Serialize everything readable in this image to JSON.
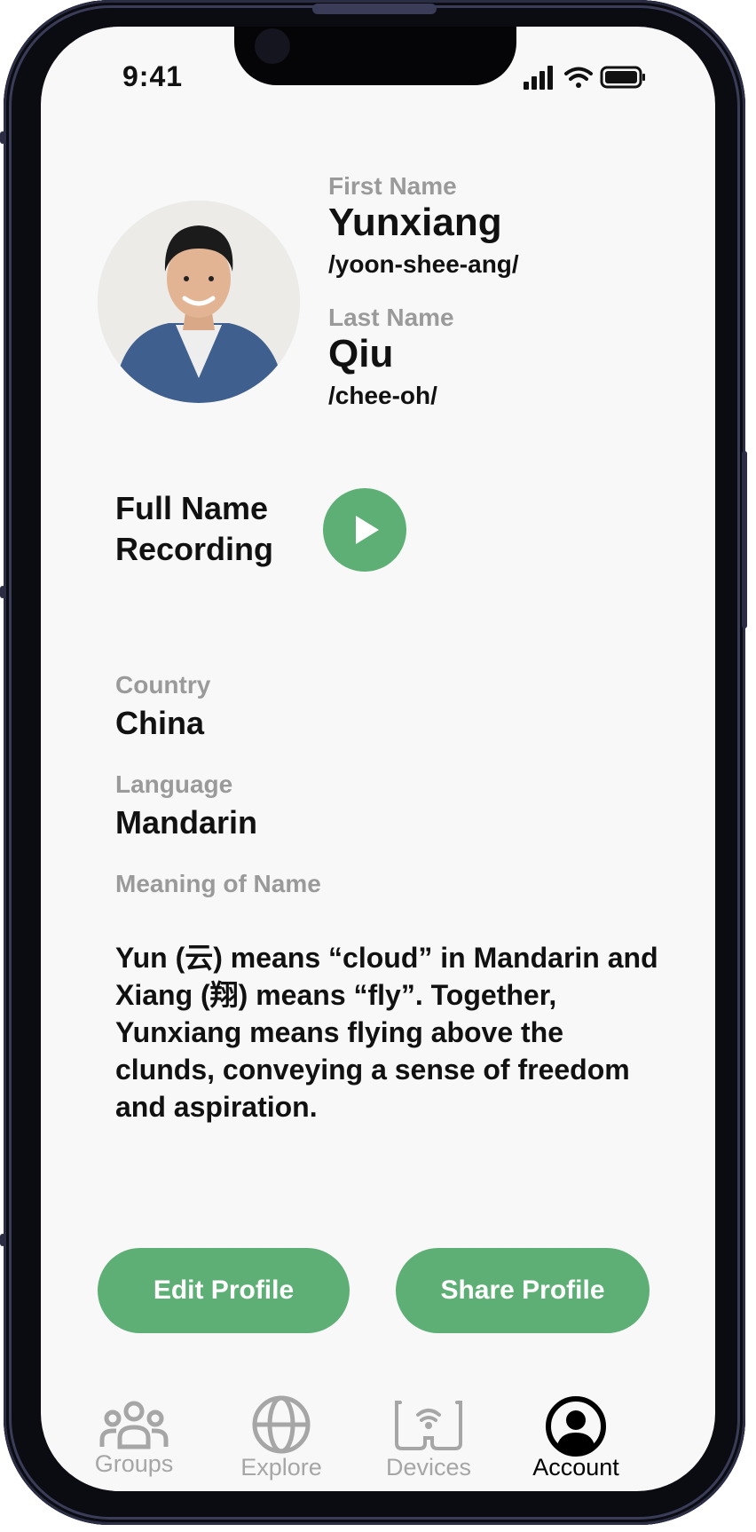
{
  "status": {
    "time": "9:41"
  },
  "profile": {
    "first_name_label": "First Name",
    "first_name": "Yunxiang",
    "first_name_phonetic": "/yoon-shee-ang/",
    "last_name_label": "Last Name",
    "last_name": "Qiu",
    "last_name_phonetic": "/chee-oh/",
    "recording_label_line1": "Full Name",
    "recording_label_line2": "Recording",
    "country_label": "Country",
    "country": "China",
    "language_label": "Language",
    "language": "Mandarin",
    "meaning_label": "Meaning of Name",
    "meaning": "Yun (云) means “cloud” in Mandarin and Xiang (翔) means  “fly”. Together, Yunxiang means flying above the clunds, conveying a sense of freedom and aspiration."
  },
  "actions": {
    "edit_label": "Edit Profile",
    "share_label": "Share Profile"
  },
  "tabs": [
    {
      "label": "Groups",
      "icon": "groups-icon",
      "active": false
    },
    {
      "label": "Explore",
      "icon": "globe-icon",
      "active": false
    },
    {
      "label": "Devices",
      "icon": "glasses-wifi-icon",
      "active": false
    },
    {
      "label": "Account",
      "icon": "account-icon",
      "active": true
    }
  ],
  "colors": {
    "accent": "#5eaf75",
    "label_gray": "#9a9a9a",
    "text": "#111111",
    "inactive_tab": "#a6a6a6"
  }
}
